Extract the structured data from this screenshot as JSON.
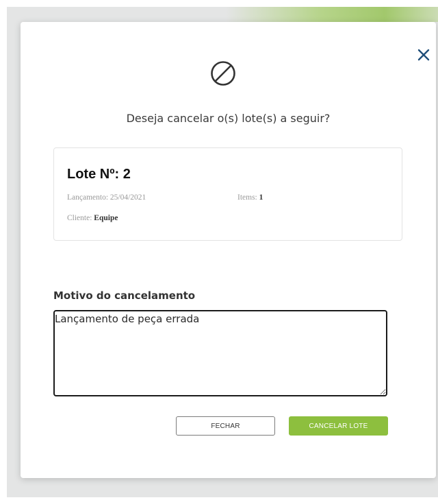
{
  "colors": {
    "accent_green": "#8dbf3e",
    "close_blue": "#1f4e79",
    "overlay_gray": "#e4e5e5"
  },
  "modal": {
    "close_icon": "close-icon",
    "ban_icon": "ban-icon",
    "question": "Deseja cancelar o(s) lote(s) a seguir?",
    "lote": {
      "title": "Lote Nº: 2",
      "lancamento_label": "Lançamento: ",
      "lancamento_value": "25/04/2021",
      "items_label": "Items: ",
      "items_value": "1",
      "cliente_label": "Cliente: ",
      "cliente_value": "Equipe"
    },
    "motivo": {
      "label": "Motivo do cancelamento",
      "value": "Lançamento de peça errada"
    },
    "buttons": {
      "fechar": "FECHAR",
      "cancelar": "CANCELAR LOTE"
    }
  }
}
